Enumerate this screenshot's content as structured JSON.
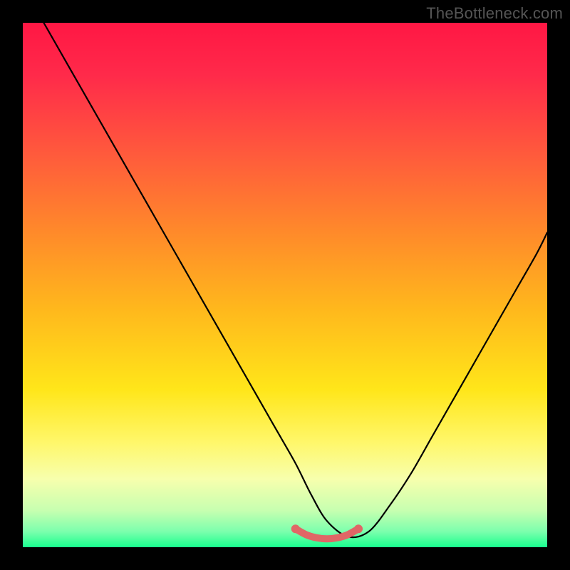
{
  "watermark": "TheBottleneck.com",
  "colors": {
    "gradient_stops": [
      {
        "offset": 0.0,
        "color": "#ff1744"
      },
      {
        "offset": 0.1,
        "color": "#ff2a4a"
      },
      {
        "offset": 0.25,
        "color": "#ff5a3c"
      },
      {
        "offset": 0.4,
        "color": "#ff8a2a"
      },
      {
        "offset": 0.55,
        "color": "#ffb91c"
      },
      {
        "offset": 0.7,
        "color": "#ffe61a"
      },
      {
        "offset": 0.8,
        "color": "#fff76a"
      },
      {
        "offset": 0.87,
        "color": "#f7ffad"
      },
      {
        "offset": 0.93,
        "color": "#c7ffb0"
      },
      {
        "offset": 0.97,
        "color": "#7cffad"
      },
      {
        "offset": 1.0,
        "color": "#19ff8f"
      }
    ],
    "curve": "#000000",
    "marker": "#e06666",
    "frame": "#000000"
  },
  "chart_data": {
    "type": "line",
    "title": "",
    "xlabel": "",
    "ylabel": "",
    "xlim": [
      0,
      100
    ],
    "ylim": [
      0,
      100
    ],
    "series": [
      {
        "name": "bottleneck-curve",
        "x": [
          4,
          8,
          12,
          16,
          20,
          24,
          28,
          32,
          36,
          40,
          44,
          48,
          52,
          55,
          58,
          62,
          66,
          70,
          74,
          78,
          82,
          86,
          90,
          94,
          98,
          100
        ],
        "y": [
          100,
          93,
          86,
          79,
          72,
          65,
          58,
          51,
          44,
          37,
          30,
          23,
          16,
          10,
          5,
          2,
          3,
          8,
          14,
          21,
          28,
          35,
          42,
          49,
          56,
          60
        ]
      },
      {
        "name": "optimal-band",
        "x": [
          52,
          54,
          56,
          58,
          60,
          62,
          64
        ],
        "y": [
          3.5,
          2.4,
          1.8,
          1.6,
          1.8,
          2.4,
          3.5
        ]
      }
    ],
    "optimal_x_range": [
      52,
      64
    ],
    "optimal_y": 2
  }
}
